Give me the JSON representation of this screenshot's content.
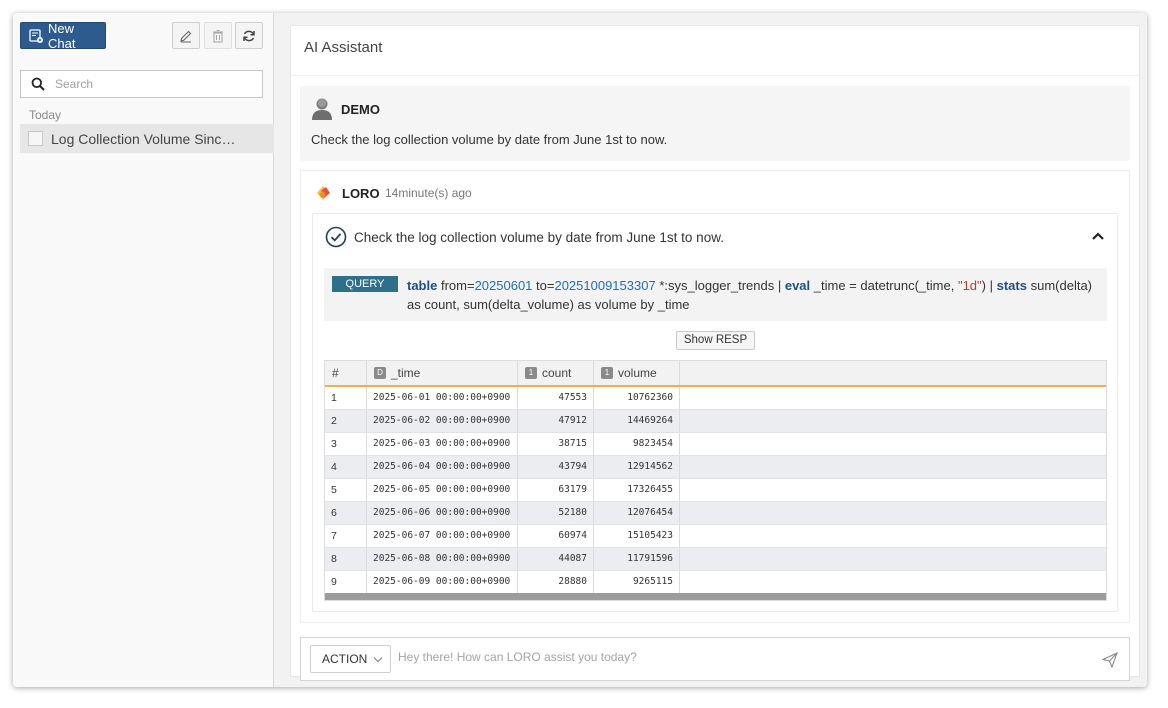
{
  "sidebar": {
    "new_chat_label": "New Chat",
    "search_placeholder": "Search",
    "group_label": "Today",
    "chats": [
      {
        "label": "Log Collection Volume Since J..."
      }
    ]
  },
  "main": {
    "title": "AI Assistant",
    "user_message": {
      "name": "DEMO",
      "text": "Check the log collection volume by date from June 1st to now."
    },
    "bot_message": {
      "name": "LORO",
      "time": "14minute(s) ago",
      "task_title": "Check the log collection volume by date from June 1st to now.",
      "query_badge": "QUERY",
      "query": {
        "kw_table": "table",
        "from_label": "from=",
        "from_value": "20250601",
        "to_label": "to=",
        "to_value": "20251009153307",
        "source": "*:sys_logger_trends |",
        "kw_eval": "eval",
        "eval_expr": "_time = datetrunc(_time,",
        "eval_arg": "\"1d\"",
        "eval_close": ") |",
        "kw_stats": "stats",
        "stats_expr": "sum(delta) as count, sum(delta_volume) as volume by _time"
      },
      "show_resp_label": "Show RESP",
      "table": {
        "columns": [
          {
            "label": "#",
            "type_badge": ""
          },
          {
            "label": "_time",
            "type_badge": "D"
          },
          {
            "label": "count",
            "type_badge": "1"
          },
          {
            "label": "volume",
            "type_badge": "1"
          }
        ],
        "rows": [
          {
            "idx": "1",
            "time": "2025-06-01 00:00:00+0900",
            "count": "47553",
            "volume": "10762360"
          },
          {
            "idx": "2",
            "time": "2025-06-02 00:00:00+0900",
            "count": "47912",
            "volume": "14469264"
          },
          {
            "idx": "3",
            "time": "2025-06-03 00:00:00+0900",
            "count": "38715",
            "volume": "9823454"
          },
          {
            "idx": "4",
            "time": "2025-06-04 00:00:00+0900",
            "count": "43794",
            "volume": "12914562"
          },
          {
            "idx": "5",
            "time": "2025-06-05 00:00:00+0900",
            "count": "63179",
            "volume": "17326455"
          },
          {
            "idx": "6",
            "time": "2025-06-06 00:00:00+0900",
            "count": "52180",
            "volume": "12076454"
          },
          {
            "idx": "7",
            "time": "2025-06-07 00:00:00+0900",
            "count": "60974",
            "volume": "15105423"
          },
          {
            "idx": "8",
            "time": "2025-06-08 00:00:00+0900",
            "count": "44087",
            "volume": "11791596"
          },
          {
            "idx": "9",
            "time": "2025-06-09 00:00:00+0900",
            "count": "28880",
            "volume": "9265115"
          }
        ]
      }
    },
    "input_bar": {
      "action_label": "ACTION",
      "placeholder": "Hey there! How can LORO assist you today?"
    }
  },
  "colors": {
    "primary_button": "#2e5b8d",
    "query_badge": "#2e6f8a",
    "table_header_accent": "#f0b048",
    "keyword": "#1f4f8a",
    "number": "#1e6fb8",
    "string": "#b3402e"
  },
  "icons": [
    "new-chat-icon",
    "edit-icon",
    "trash-icon",
    "refresh-icon",
    "search-icon",
    "user-avatar-icon",
    "loro-logo-icon",
    "check-circle-icon",
    "chevron-up-icon",
    "chevron-down-icon",
    "send-icon"
  ]
}
